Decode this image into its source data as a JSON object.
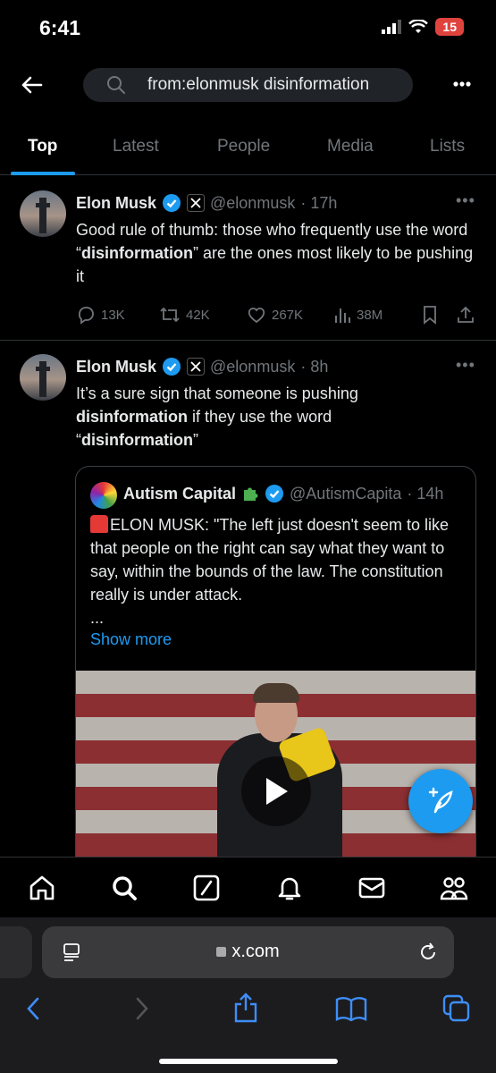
{
  "status": {
    "time": "6:41",
    "battery": "15"
  },
  "search": {
    "query": "from:elonmusk disinformation"
  },
  "tabs": [
    "Top",
    "Latest",
    "People",
    "Media",
    "Lists"
  ],
  "tweets": [
    {
      "name": "Elon Musk",
      "handle": "@elonmusk",
      "time": "· 17h",
      "text_html_parts": [
        "Good rule of thumb: those who frequently use the word “",
        "disinformation",
        "” are the ones most likely to be pushing it"
      ],
      "stats": {
        "replies": "13K",
        "retweets": "42K",
        "likes": "267K",
        "views": "38M"
      }
    },
    {
      "name": "Elon Musk",
      "handle": "@elonmusk",
      "time": "· 8h",
      "text_parts": [
        "It’s a sure sign that someone is pushing ",
        "disinformation",
        " if they use the word “",
        "disinformation",
        "”"
      ],
      "quote": {
        "name": "Autism Capital",
        "handle": "@AutismCapita",
        "time": "· 14h",
        "text": "ELON MUSK: \"The left just doesn't seem to like that people on the right can say what they want to say, within the bounds of the law. The constitution really is under attack.",
        "ellipsis": "...",
        "show_more": "Show more"
      }
    }
  ],
  "safari": {
    "url": "x.com"
  },
  "colors": {
    "accent": "#1d9bf0",
    "background": "#000000",
    "muted": "#71767b"
  }
}
